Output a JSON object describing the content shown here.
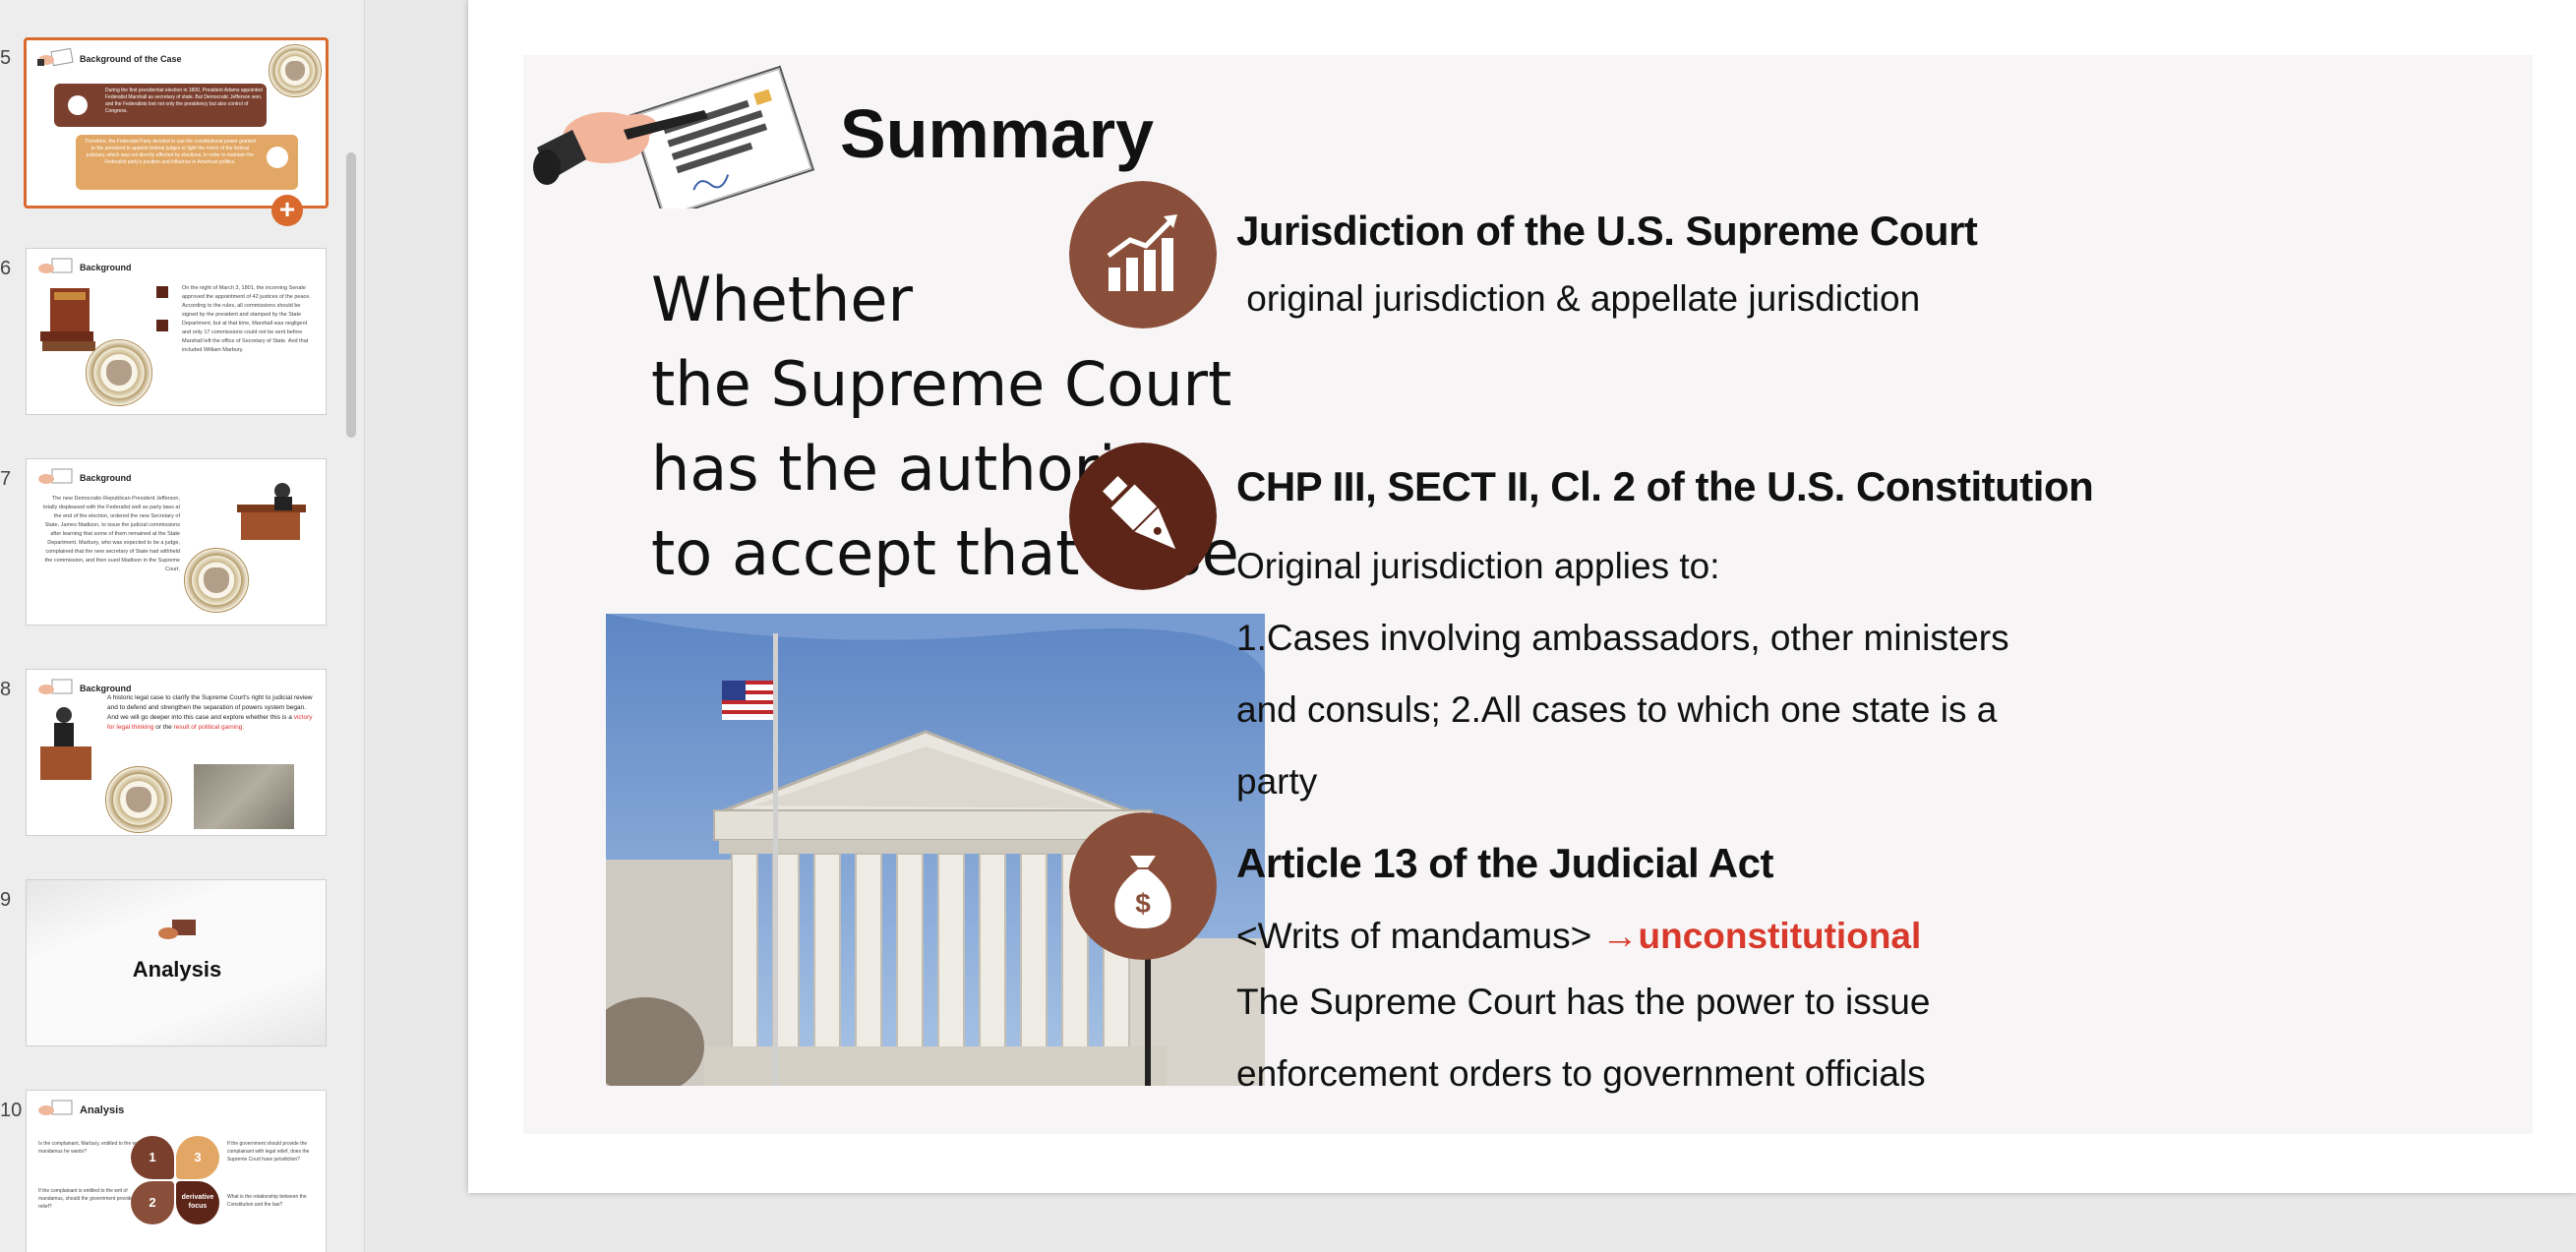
{
  "colors": {
    "accent_orange": "#d9692c",
    "brown_light": "#8a4f3a",
    "brown_dark": "#5c2517",
    "red_emphasis": "#d8392b"
  },
  "thumbnails": [
    {
      "number": "5",
      "title": "Background of the Case",
      "selected": true,
      "text_a": "During the first presidential election in 1800, President Adams appointed Federalist Marshall as secretary of state. But Democratic Jefferson won, and the Federalists lost not only the presidency but also control of Congress.",
      "text_b": "Therefore, the Federalist Party decided to use the constitutional power granted to the president to appoint federal judges to fight the mirror of the federal judiciary, which was not directly affected by elections, in order to maintain the Federalist party's position and influence in American politics."
    },
    {
      "number": "6",
      "title": "Background",
      "text": "On the night of March 3, 1801, the incoming Senate approved the appointment of 42 justices of the peace. According to the rules, all commissions should be signed by the president and stamped by the State Department, but at that time, Marshall was negligent and only 17 commissions could not be sent before Marshall left the office of Secretary of State. And that included William Marbury."
    },
    {
      "number": "7",
      "title": "Background",
      "text": "The new Democratic-Republican President Jefferson, totally displeased with the Federalist well as party laws at the end of the election, ordered the new Secretary of State, James Madison, to issue the judicial commissions after learning that some of them remained at the State Department. Marbury, who was expected to be a judge, complained that the new secretary of State had withheld the commission, and then sued Madison in the Supreme Court."
    },
    {
      "number": "8",
      "title": "Background",
      "text_a": "A historic legal case to clarify the Supreme Court's right to judicial review and to defend and strengthen the separation of powers system began.",
      "text_b": "And we will go deeper into this case and explore whether this is a",
      "red_a": "victory for legal thinking",
      "or": "or the",
      "red_b": "result of political gaming."
    },
    {
      "number": "9",
      "title": "Analysis"
    },
    {
      "number": "10",
      "title": "Analysis",
      "q1": "Is the complainant, Marbury, entitled to the writ of mandamus he wants?",
      "q2": "If the complainant is entitled to the writ of mandamus, should the government provide legal relief?",
      "q3": "If the government should provide the complainant with legal relief, does the Supreme Court have jurisdiction?",
      "q4": "What is the relationship between the Constitution and the law?",
      "n1": "1",
      "n2": "2",
      "n3": "3",
      "center": "derivative focus"
    }
  ],
  "add_button_label": "+",
  "slide": {
    "title": "Summary",
    "question_lines": [
      "Whether",
      "the Supreme Court",
      "has the authority",
      "to accept that case"
    ],
    "items": [
      {
        "icon": "chart-icon",
        "heading": "Jurisdiction of the U.S. Supreme Court",
        "body": " original jurisdiction & appellate jurisdiction"
      },
      {
        "icon": "pen-icon",
        "heading": "CHP III, SECT II, Cl. 2 of the U.S. Constitution",
        "body_lines": [
          "Original jurisdiction applies to:",
          "1.Cases involving ambassadors, other ministers",
          "and consuls; 2.All cases to which one state is a",
          "party"
        ]
      },
      {
        "icon": "money-bag-icon",
        "heading": "Article 13 of the Judicial Act",
        "writs": "<Writs of mandamus> ",
        "arrow_text": "→unconstitutional",
        "body_lines": [
          "The Supreme Court has the power to issue",
          "enforcement orders to government officials"
        ]
      }
    ]
  }
}
